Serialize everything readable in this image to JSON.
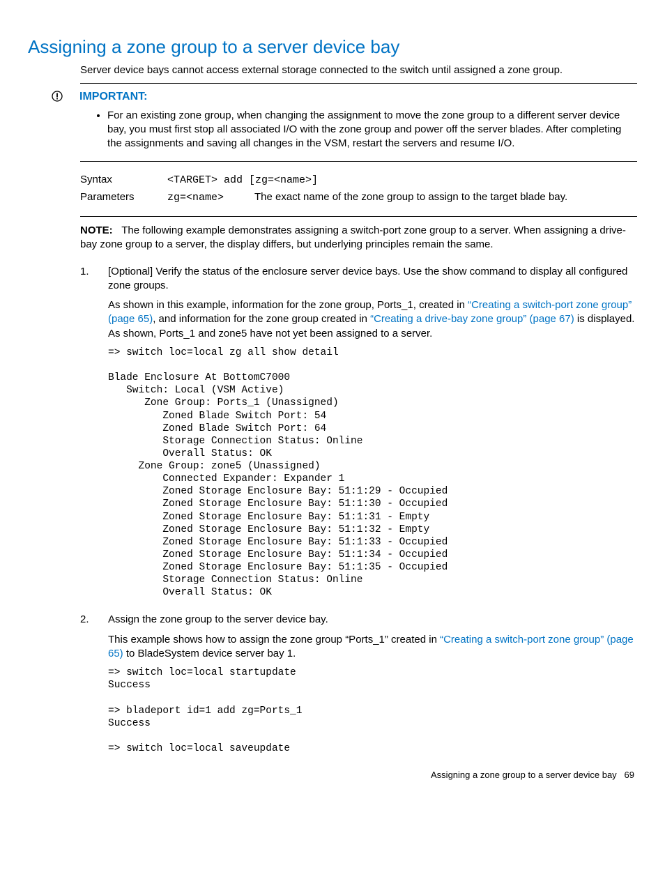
{
  "title": "Assigning a zone group to a server device bay",
  "intro": "Server device bays cannot access external storage connected to the switch until assigned a zone group.",
  "important": {
    "label": "IMPORTANT:",
    "bullet": "For an existing zone group, when changing the assignment to move the zone group to a different server device bay, you must first stop all associated I/O with the zone group and power off the server blades. After completing the assignments and saving all changes in the VSM, restart the servers and resume I/O."
  },
  "syntax": {
    "label": "Syntax",
    "code": "<TARGET> add [zg=<name>]",
    "params_label": "Parameters",
    "param_name": "zg=<name>",
    "param_desc": "The exact name of the zone group to assign to the target blade bay."
  },
  "note": {
    "label": "NOTE:",
    "text": "The following example demonstrates assigning a switch-port zone group to a server. When assigning a drive-bay zone group to a server, the display differs, but underlying principles remain the same."
  },
  "steps": {
    "s1": {
      "p1": "[Optional] Verify the status of the enclosure server device bays. Use the show command to display all configured zone groups.",
      "p2a": "As shown in this example, information for the zone group, Ports_1, created in ",
      "link1": "“Creating a switch-port zone group” (page 65)",
      "p2b": ", and information for the zone group created in ",
      "link2": "“Creating a drive-bay zone group” (page 67)",
      "p2c": " is displayed. As shown, Ports_1 and zone5 have not yet been assigned to a server.",
      "code": "=> switch loc=local zg all show detail\n\nBlade Enclosure At BottomC7000\n   Switch: Local (VSM Active)\n      Zone Group: Ports_1 (Unassigned)\n         Zoned Blade Switch Port: 54\n         Zoned Blade Switch Port: 64\n         Storage Connection Status: Online\n         Overall Status: OK\n     Zone Group: zone5 (Unassigned)\n         Connected Expander: Expander 1\n         Zoned Storage Enclosure Bay: 51:1:29 - Occupied\n         Zoned Storage Enclosure Bay: 51:1:30 - Occupied\n         Zoned Storage Enclosure Bay: 51:1:31 - Empty\n         Zoned Storage Enclosure Bay: 51:1:32 - Empty\n         Zoned Storage Enclosure Bay: 51:1:33 - Occupied\n         Zoned Storage Enclosure Bay: 51:1:34 - Occupied\n         Zoned Storage Enclosure Bay: 51:1:35 - Occupied\n         Storage Connection Status: Online\n         Overall Status: OK"
    },
    "s2": {
      "p1": "Assign the zone group to the server device bay.",
      "p2a": "This example shows how to assign the zone group “Ports_1” created in ",
      "link1": "“Creating a switch-port zone group” (page 65)",
      "p2b": " to BladeSystem device server bay 1.",
      "code": "=> switch loc=local startupdate\nSuccess\n\n=> bladeport id=1 add zg=Ports_1\nSuccess\n\n=> switch loc=local saveupdate"
    }
  },
  "footer": {
    "text": "Assigning a zone group to a server device bay",
    "page": "69"
  }
}
